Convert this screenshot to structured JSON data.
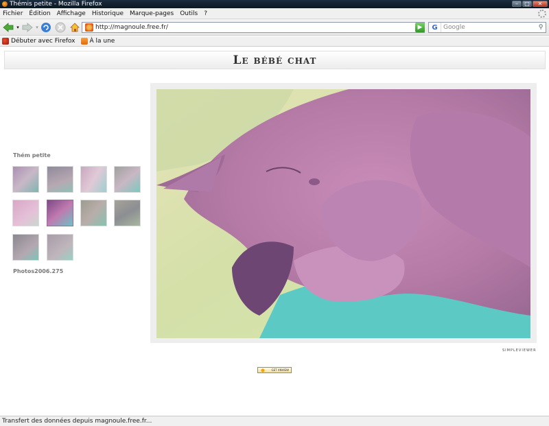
{
  "window": {
    "title": "Thémis petite - Mozilla Firefox"
  },
  "menu": {
    "items": [
      "Fichier",
      "Édition",
      "Affichage",
      "Historique",
      "Marque-pages",
      "Outils",
      "?"
    ]
  },
  "navbar": {
    "url": "http://magnoule.free.fr/",
    "search_placeholder": "Google",
    "search_engine_icon": "G"
  },
  "bookmarks": {
    "items": [
      {
        "label": "Débuter avec Firefox",
        "icon": "firefox-icon"
      },
      {
        "label": "À la une",
        "icon": "rss-icon"
      }
    ]
  },
  "page": {
    "heading": "Le bébé chat",
    "gallery_title": "Thém petite",
    "gallery_count": "Photos2006.275",
    "credit": "SIMPLEVIEWER",
    "badge": "GET XNVIEW"
  },
  "status": {
    "text": "Transfert des données depuis magnoule.free.fr..."
  },
  "colors": {
    "titlebar": "#12202e",
    "chrome": "#f0f0f0",
    "frame": "#eeeeee",
    "accent": "#3266c8"
  }
}
